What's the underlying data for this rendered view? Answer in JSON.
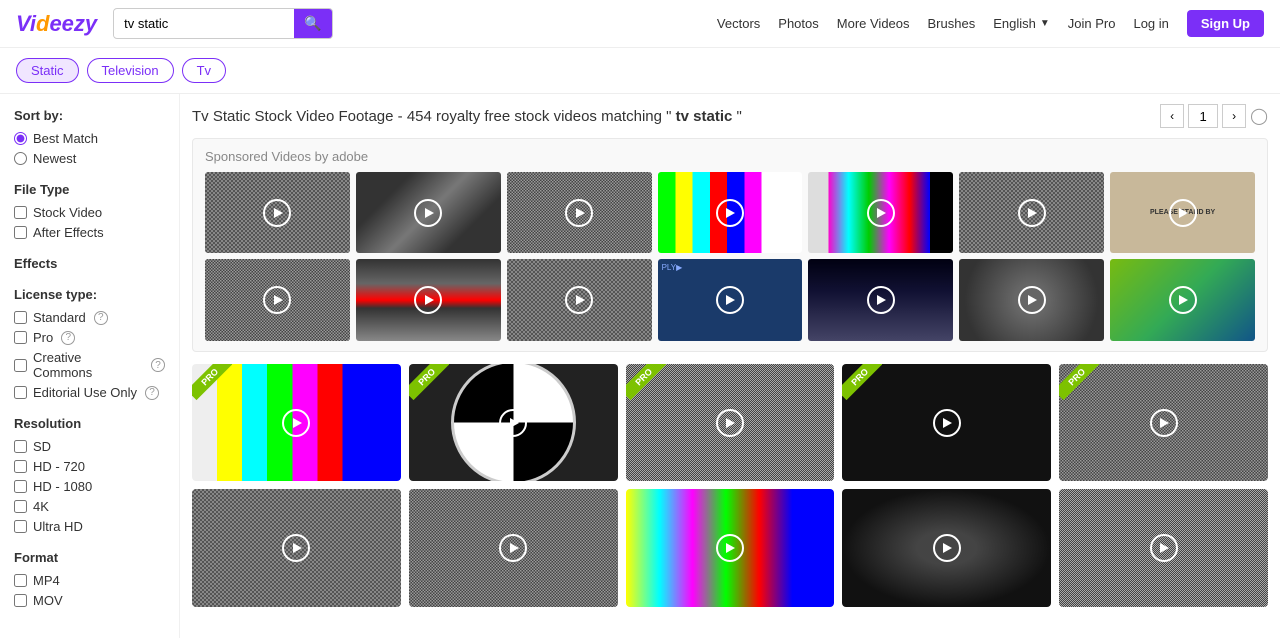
{
  "header": {
    "logo_text": "Videezy",
    "search_value": "tv static",
    "nav": {
      "vectors": "Vectors",
      "photos": "Photos",
      "more_videos": "More Videos",
      "brushes": "Brushes",
      "language": "English",
      "join_pro": "Join Pro",
      "login": "Log in",
      "signup": "Sign Up"
    }
  },
  "tags": [
    "Static",
    "Television",
    "Tv"
  ],
  "sort": {
    "label": "Sort by:",
    "options": [
      "Best Match",
      "Newest"
    ]
  },
  "file_type": {
    "label": "File Type",
    "options": [
      "Stock Video",
      "After Effects"
    ]
  },
  "license": {
    "label": "License type:",
    "options": [
      "Standard",
      "Pro",
      "Creative Commons",
      "Editorial Use Only"
    ]
  },
  "resolution": {
    "label": "Resolution",
    "options": [
      "SD",
      "HD - 720",
      "HD - 1080",
      "4K",
      "Ultra HD"
    ]
  },
  "format": {
    "label": "Format",
    "options": [
      "MP4",
      "MOV"
    ]
  },
  "results": {
    "title": "Tv Static Stock Video Footage",
    "count": "- 454 royalty free stock videos matching",
    "query": " tv static ",
    "page_current": "1",
    "sponsored_label": "Sponsored Videos by adobe"
  },
  "effects": {
    "label": "Effects"
  }
}
